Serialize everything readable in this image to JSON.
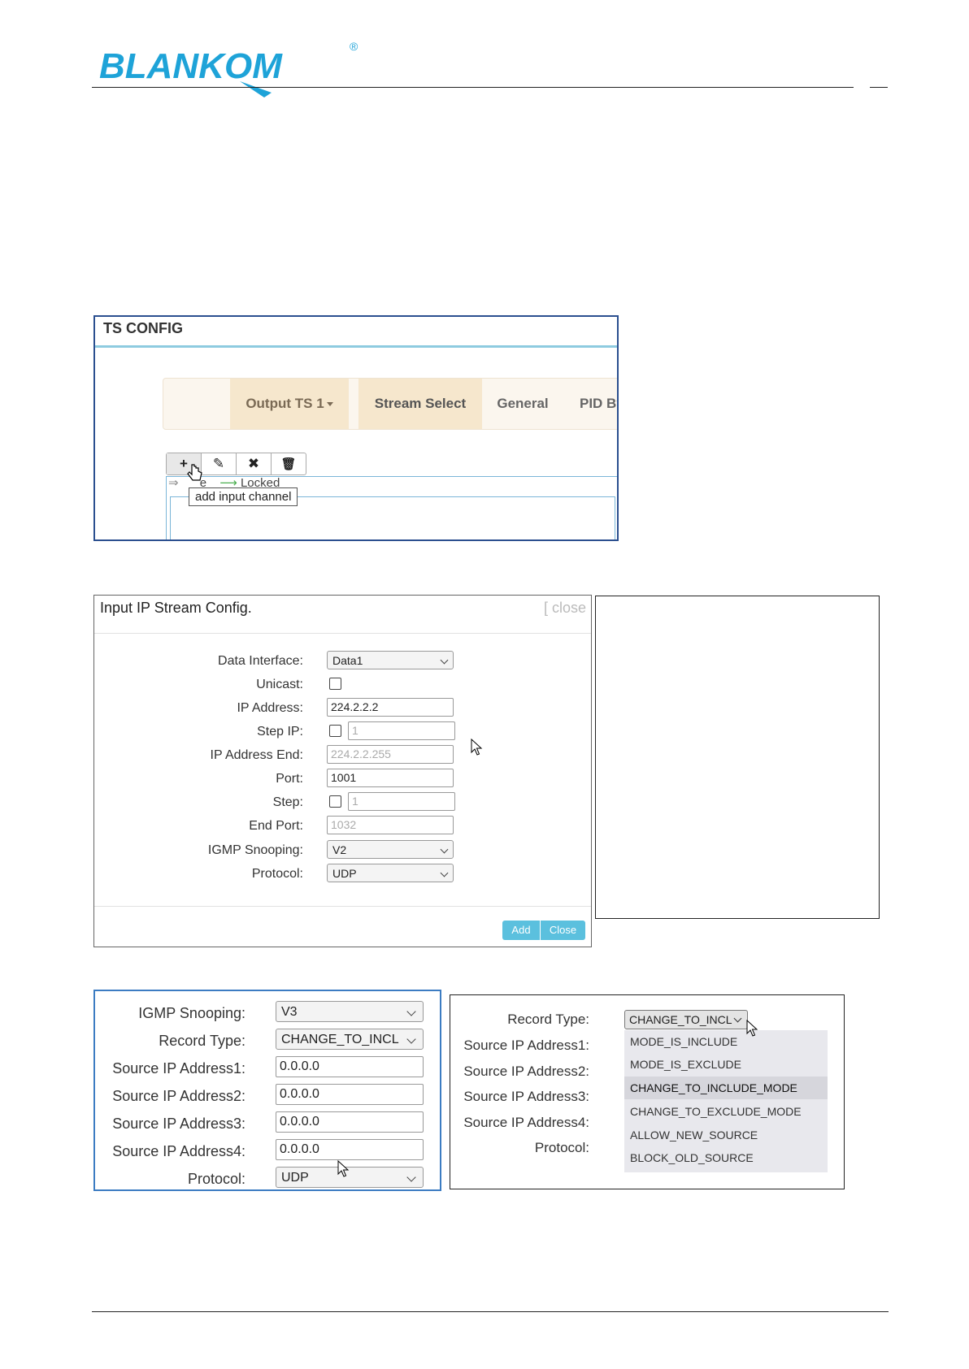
{
  "header": {
    "brand": "BLANKOM",
    "registered": "®"
  },
  "ts_config": {
    "title": "TS CONFIG",
    "tabs": [
      {
        "label": "Output TS 1"
      },
      {
        "label": "Stream Select"
      },
      {
        "label": "General"
      },
      {
        "label": "PID By"
      }
    ],
    "toolbar": {
      "add": "+",
      "edit": "✎",
      "remove": "✖",
      "delete": "🗑"
    },
    "legend": {
      "item1": "⇒",
      "item1_label": "e",
      "item2": "⟶",
      "item2_label": "Locked"
    },
    "tooltip": "add input channel"
  },
  "ip_stream": {
    "title": "Input IP Stream Config.",
    "close_link": "[ close",
    "fields": {
      "data_interface": {
        "label": "Data Interface:",
        "value": "Data1"
      },
      "unicast": {
        "label": "Unicast:"
      },
      "ip_address": {
        "label": "IP Address:",
        "value": "224.2.2.2"
      },
      "step_ip": {
        "label": "Step IP:",
        "value": "1"
      },
      "ip_address_end": {
        "label": "IP Address End:",
        "value": "224.2.2.255"
      },
      "port": {
        "label": "Port:",
        "value": "1001"
      },
      "step": {
        "label": "Step:",
        "value": "1"
      },
      "end_port": {
        "label": "End Port:",
        "value": "1032"
      },
      "igmp": {
        "label": "IGMP Snooping:",
        "value": "V2"
      },
      "protocol": {
        "label": "Protocol:",
        "value": "UDP"
      }
    },
    "add_button": "Add",
    "close_button": "Close"
  },
  "v3_panel": {
    "igmp": {
      "label": "IGMP Snooping:",
      "value": "V3"
    },
    "record_type": {
      "label": "Record Type:",
      "value": "CHANGE_TO_INCL"
    },
    "src1": {
      "label": "Source IP Address1:",
      "value": "0.0.0.0"
    },
    "src2": {
      "label": "Source IP Address2:",
      "value": "0.0.0.0"
    },
    "src3": {
      "label": "Source IP Address3:",
      "value": "0.0.0.0"
    },
    "src4": {
      "label": "Source IP Address4:",
      "value": "0.0.0.0"
    },
    "protocol": {
      "label": "Protocol:",
      "value": "UDP"
    }
  },
  "record_dropdown": {
    "record_type_label": "Record Type:",
    "selected": "CHANGE_TO_INCL",
    "labels": [
      "Source IP Address1:",
      "Source IP Address2:",
      "Source IP Address3:",
      "Source IP Address4:",
      "Protocol:"
    ],
    "options": [
      "MODE_IS_INCLUDE",
      "MODE_IS_EXCLUDE",
      "CHANGE_TO_INCLUDE_MODE",
      "CHANGE_TO_EXCLUDE_MODE",
      "ALLOW_NEW_SOURCE",
      "BLOCK_OLD_SOURCE"
    ],
    "highlighted_index": 2
  },
  "colors": {
    "brand": "#1ea3d8",
    "accent_button": "#5bc0de",
    "tab_active": "#f6e7cd"
  }
}
